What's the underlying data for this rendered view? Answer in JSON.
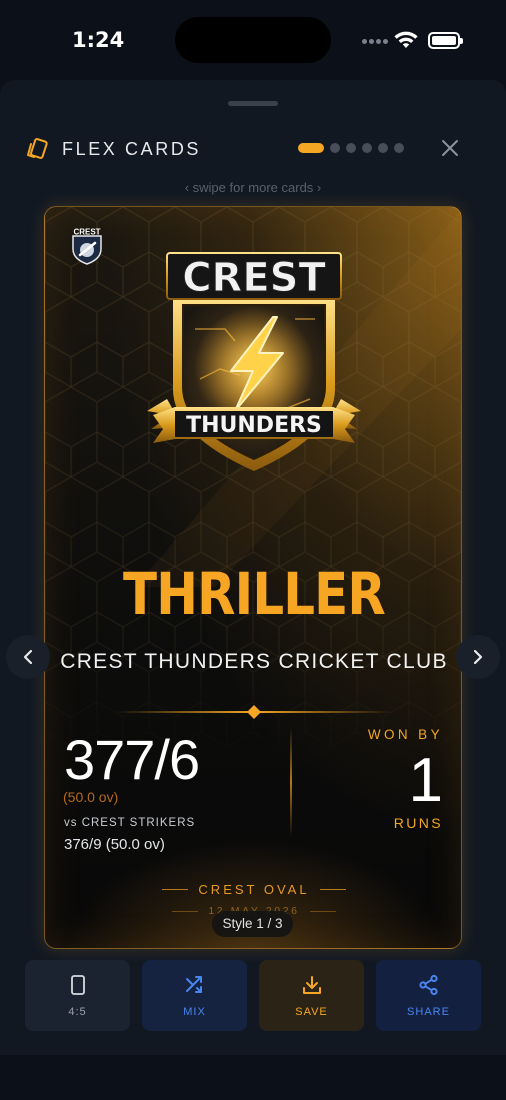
{
  "status_bar": {
    "time": "1:24"
  },
  "sheet": {
    "title": "FLEX CARDS",
    "swipe_hint": "‹  swipe for more cards  ›",
    "pager": {
      "total": 6,
      "active_index": 0
    }
  },
  "card": {
    "mini_logo_text": "CREST",
    "badge": {
      "top_text": "CREST",
      "bottom_text": "THUNDERS"
    },
    "headline": "THRILLER",
    "club_name": "CREST THUNDERS CRICKET CLUB",
    "team_score": "377/6",
    "team_overs": "(50.0 ov)",
    "opponent_label": "vs CREST STRIKERS",
    "opponent_score": "376/9 (50.0 ov)",
    "result_label": "WON BY",
    "result_margin": "1",
    "result_unit": "RUNS",
    "venue": "CREST OVAL",
    "date": "12 MAY 2026",
    "style_indicator": "Style 1 / 3"
  },
  "toolbar": {
    "ratio_label": "4:5",
    "mix_label": "MIX",
    "save_label": "SAVE",
    "share_label": "SHARE"
  },
  "colors": {
    "accent": "#f5a623",
    "blue": "#4a86f0",
    "background": "#0c1119",
    "sheet": "#111822"
  },
  "icons": [
    "wifi-icon",
    "battery-icon",
    "cards-icon",
    "close-icon",
    "chevron-left-icon",
    "chevron-right-icon",
    "phone-frame-icon",
    "shuffle-icon",
    "download-icon",
    "share-icon"
  ]
}
